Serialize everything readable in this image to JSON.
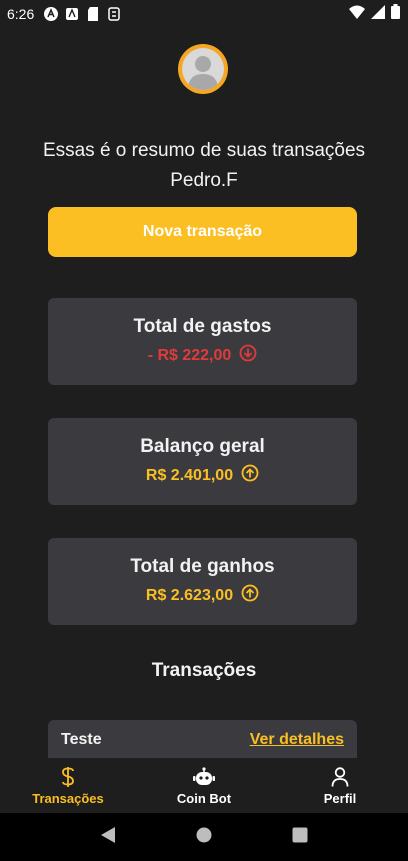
{
  "status_bar": {
    "time": "6:26"
  },
  "header": {
    "summary": "Essas é o resumo de suas transações Pedro.F",
    "new_transaction_label": "Nova transação"
  },
  "cards": [
    {
      "title": "Total de gastos",
      "value": "- R$ 222,00",
      "direction": "down",
      "color": "#e03a3a"
    },
    {
      "title": "Balanço geral",
      "value": "R$ 2.401,00",
      "direction": "up",
      "color": "#fbbf24"
    },
    {
      "title": "Total de ganhos",
      "value": "R$ 2.623,00",
      "direction": "up",
      "color": "#fbbf24"
    }
  ],
  "transactions": {
    "title": "Transações",
    "items": [
      {
        "name": "Teste",
        "link_label": "Ver detalhes"
      }
    ]
  },
  "bottom_nav": {
    "items": [
      {
        "label": "Transações",
        "icon": "dollar-icon",
        "active": true
      },
      {
        "label": "Coin Bot",
        "icon": "robot-icon",
        "active": false
      },
      {
        "label": "Perfil",
        "icon": "person-icon",
        "active": false
      }
    ]
  },
  "colors": {
    "accent": "#fbbf24",
    "negative": "#e03a3a",
    "card_bg": "#3b3b3f",
    "background": "#1e1e1e"
  }
}
